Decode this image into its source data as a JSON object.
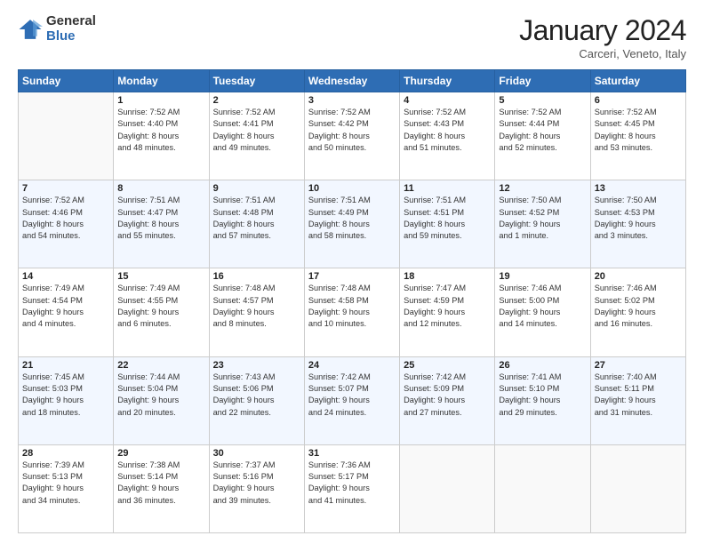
{
  "logo": {
    "general": "General",
    "blue": "Blue"
  },
  "header": {
    "month": "January 2024",
    "location": "Carceri, Veneto, Italy"
  },
  "weekdays": [
    "Sunday",
    "Monday",
    "Tuesday",
    "Wednesday",
    "Thursday",
    "Friday",
    "Saturday"
  ],
  "weeks": [
    [
      {
        "day": "",
        "info": ""
      },
      {
        "day": "1",
        "info": "Sunrise: 7:52 AM\nSunset: 4:40 PM\nDaylight: 8 hours\nand 48 minutes."
      },
      {
        "day": "2",
        "info": "Sunrise: 7:52 AM\nSunset: 4:41 PM\nDaylight: 8 hours\nand 49 minutes."
      },
      {
        "day": "3",
        "info": "Sunrise: 7:52 AM\nSunset: 4:42 PM\nDaylight: 8 hours\nand 50 minutes."
      },
      {
        "day": "4",
        "info": "Sunrise: 7:52 AM\nSunset: 4:43 PM\nDaylight: 8 hours\nand 51 minutes."
      },
      {
        "day": "5",
        "info": "Sunrise: 7:52 AM\nSunset: 4:44 PM\nDaylight: 8 hours\nand 52 minutes."
      },
      {
        "day": "6",
        "info": "Sunrise: 7:52 AM\nSunset: 4:45 PM\nDaylight: 8 hours\nand 53 minutes."
      }
    ],
    [
      {
        "day": "7",
        "info": "Sunrise: 7:52 AM\nSunset: 4:46 PM\nDaylight: 8 hours\nand 54 minutes."
      },
      {
        "day": "8",
        "info": "Sunrise: 7:51 AM\nSunset: 4:47 PM\nDaylight: 8 hours\nand 55 minutes."
      },
      {
        "day": "9",
        "info": "Sunrise: 7:51 AM\nSunset: 4:48 PM\nDaylight: 8 hours\nand 57 minutes."
      },
      {
        "day": "10",
        "info": "Sunrise: 7:51 AM\nSunset: 4:49 PM\nDaylight: 8 hours\nand 58 minutes."
      },
      {
        "day": "11",
        "info": "Sunrise: 7:51 AM\nSunset: 4:51 PM\nDaylight: 8 hours\nand 59 minutes."
      },
      {
        "day": "12",
        "info": "Sunrise: 7:50 AM\nSunset: 4:52 PM\nDaylight: 9 hours\nand 1 minute."
      },
      {
        "day": "13",
        "info": "Sunrise: 7:50 AM\nSunset: 4:53 PM\nDaylight: 9 hours\nand 3 minutes."
      }
    ],
    [
      {
        "day": "14",
        "info": "Sunrise: 7:49 AM\nSunset: 4:54 PM\nDaylight: 9 hours\nand 4 minutes."
      },
      {
        "day": "15",
        "info": "Sunrise: 7:49 AM\nSunset: 4:55 PM\nDaylight: 9 hours\nand 6 minutes."
      },
      {
        "day": "16",
        "info": "Sunrise: 7:48 AM\nSunset: 4:57 PM\nDaylight: 9 hours\nand 8 minutes."
      },
      {
        "day": "17",
        "info": "Sunrise: 7:48 AM\nSunset: 4:58 PM\nDaylight: 9 hours\nand 10 minutes."
      },
      {
        "day": "18",
        "info": "Sunrise: 7:47 AM\nSunset: 4:59 PM\nDaylight: 9 hours\nand 12 minutes."
      },
      {
        "day": "19",
        "info": "Sunrise: 7:46 AM\nSunset: 5:00 PM\nDaylight: 9 hours\nand 14 minutes."
      },
      {
        "day": "20",
        "info": "Sunrise: 7:46 AM\nSunset: 5:02 PM\nDaylight: 9 hours\nand 16 minutes."
      }
    ],
    [
      {
        "day": "21",
        "info": "Sunrise: 7:45 AM\nSunset: 5:03 PM\nDaylight: 9 hours\nand 18 minutes."
      },
      {
        "day": "22",
        "info": "Sunrise: 7:44 AM\nSunset: 5:04 PM\nDaylight: 9 hours\nand 20 minutes."
      },
      {
        "day": "23",
        "info": "Sunrise: 7:43 AM\nSunset: 5:06 PM\nDaylight: 9 hours\nand 22 minutes."
      },
      {
        "day": "24",
        "info": "Sunrise: 7:42 AM\nSunset: 5:07 PM\nDaylight: 9 hours\nand 24 minutes."
      },
      {
        "day": "25",
        "info": "Sunrise: 7:42 AM\nSunset: 5:09 PM\nDaylight: 9 hours\nand 27 minutes."
      },
      {
        "day": "26",
        "info": "Sunrise: 7:41 AM\nSunset: 5:10 PM\nDaylight: 9 hours\nand 29 minutes."
      },
      {
        "day": "27",
        "info": "Sunrise: 7:40 AM\nSunset: 5:11 PM\nDaylight: 9 hours\nand 31 minutes."
      }
    ],
    [
      {
        "day": "28",
        "info": "Sunrise: 7:39 AM\nSunset: 5:13 PM\nDaylight: 9 hours\nand 34 minutes."
      },
      {
        "day": "29",
        "info": "Sunrise: 7:38 AM\nSunset: 5:14 PM\nDaylight: 9 hours\nand 36 minutes."
      },
      {
        "day": "30",
        "info": "Sunrise: 7:37 AM\nSunset: 5:16 PM\nDaylight: 9 hours\nand 39 minutes."
      },
      {
        "day": "31",
        "info": "Sunrise: 7:36 AM\nSunset: 5:17 PM\nDaylight: 9 hours\nand 41 minutes."
      },
      {
        "day": "",
        "info": ""
      },
      {
        "day": "",
        "info": ""
      },
      {
        "day": "",
        "info": ""
      }
    ]
  ]
}
